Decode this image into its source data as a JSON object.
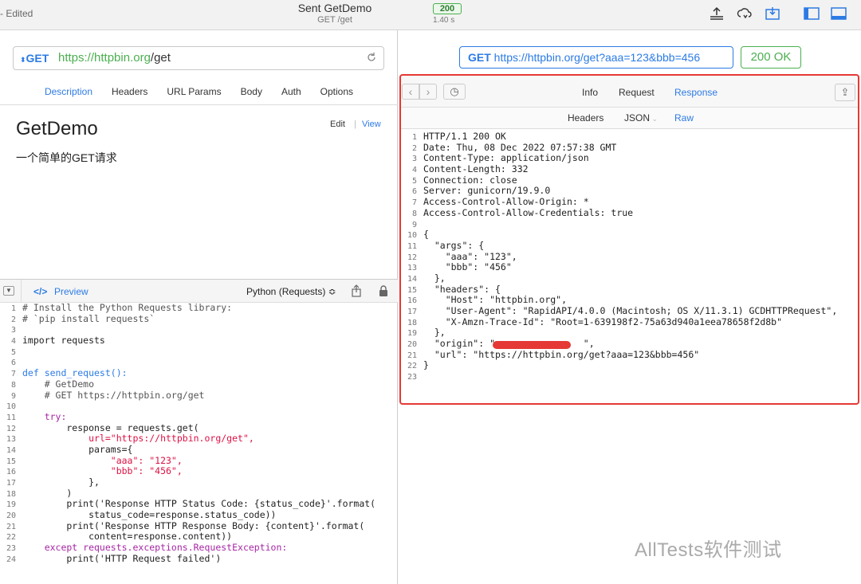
{
  "titlebar": {
    "edited": "- Edited",
    "title": "Sent GetDemo",
    "subtitle": "GET /get",
    "status_badge": "200",
    "elapsed": "1.40 s"
  },
  "request": {
    "method": "GET",
    "url_scheme": "https://",
    "url_host": "httpbin.org",
    "url_path": "/get",
    "tabs": [
      "Description",
      "Headers",
      "URL Params",
      "Body",
      "Auth",
      "Options"
    ],
    "active_tab": "Description"
  },
  "doc": {
    "name": "GetDemo",
    "description": "一个简单的GET请求",
    "edit": "Edit",
    "separator": "|",
    "view": "View"
  },
  "generator": {
    "preview_label": "Preview",
    "language": "Python (Requests) ≎"
  },
  "code_lines": [
    "# Install the Python Requests library:",
    "# `pip install requests`",
    "",
    "import requests",
    "",
    "",
    "def send_request():",
    "    # GetDemo",
    "    # GET https://httpbin.org/get",
    "",
    "    try:",
    "        response = requests.get(",
    "            url=\"https://httpbin.org/get\",",
    "            params={",
    "                \"aaa\": \"123\",",
    "                \"bbb\": \"456\",",
    "            },",
    "        )",
    "        print('Response HTTP Status Code: {status_code}'.format(",
    "            status_code=response.status_code))",
    "        print('Response HTTP Response Body: {content}'.format(",
    "            content=response.content))",
    "    except requests.exceptions.RequestException:",
    "        print('HTTP Request failed')"
  ],
  "response": {
    "method": "GET",
    "url": "https://httpbin.org/get?aaa=123&bbb=456",
    "status": "200 OK",
    "tabs": [
      "Info",
      "Request",
      "Response"
    ],
    "active_tab": "Response",
    "subtabs": [
      "Headers",
      "JSON",
      "Raw"
    ],
    "active_subtab": "Raw",
    "raw_lines": [
      "HTTP/1.1 200 OK",
      "Date: Thu, 08 Dec 2022 07:57:38 GMT",
      "Content-Type: application/json",
      "Content-Length: 332",
      "Connection: close",
      "Server: gunicorn/19.9.0",
      "Access-Control-Allow-Origin: *",
      "Access-Control-Allow-Credentials: true",
      "",
      "{",
      "  \"args\": {",
      "    \"aaa\": \"123\",",
      "    \"bbb\": \"456\"",
      "  },",
      "  \"headers\": {",
      "    \"Host\": \"httpbin.org\",",
      "    \"User-Agent\": \"RapidAPI/4.0.0 (Macintosh; OS X/11.3.1) GCDHTTPRequest\",",
      "    \"X-Amzn-Trace-Id\": \"Root=1-639198f2-75a63d940a1eea78658f2d8b\"",
      "  },",
      "  \"origin\": \"                \",",
      "  \"url\": \"https://httpbin.org/get?aaa=123&bbb=456\"",
      "}",
      ""
    ]
  },
  "watermark": "AllTests软件测试",
  "colors": {
    "accent": "#2c7be5",
    "success": "#4caf50",
    "highlight_border": "#e53935"
  }
}
